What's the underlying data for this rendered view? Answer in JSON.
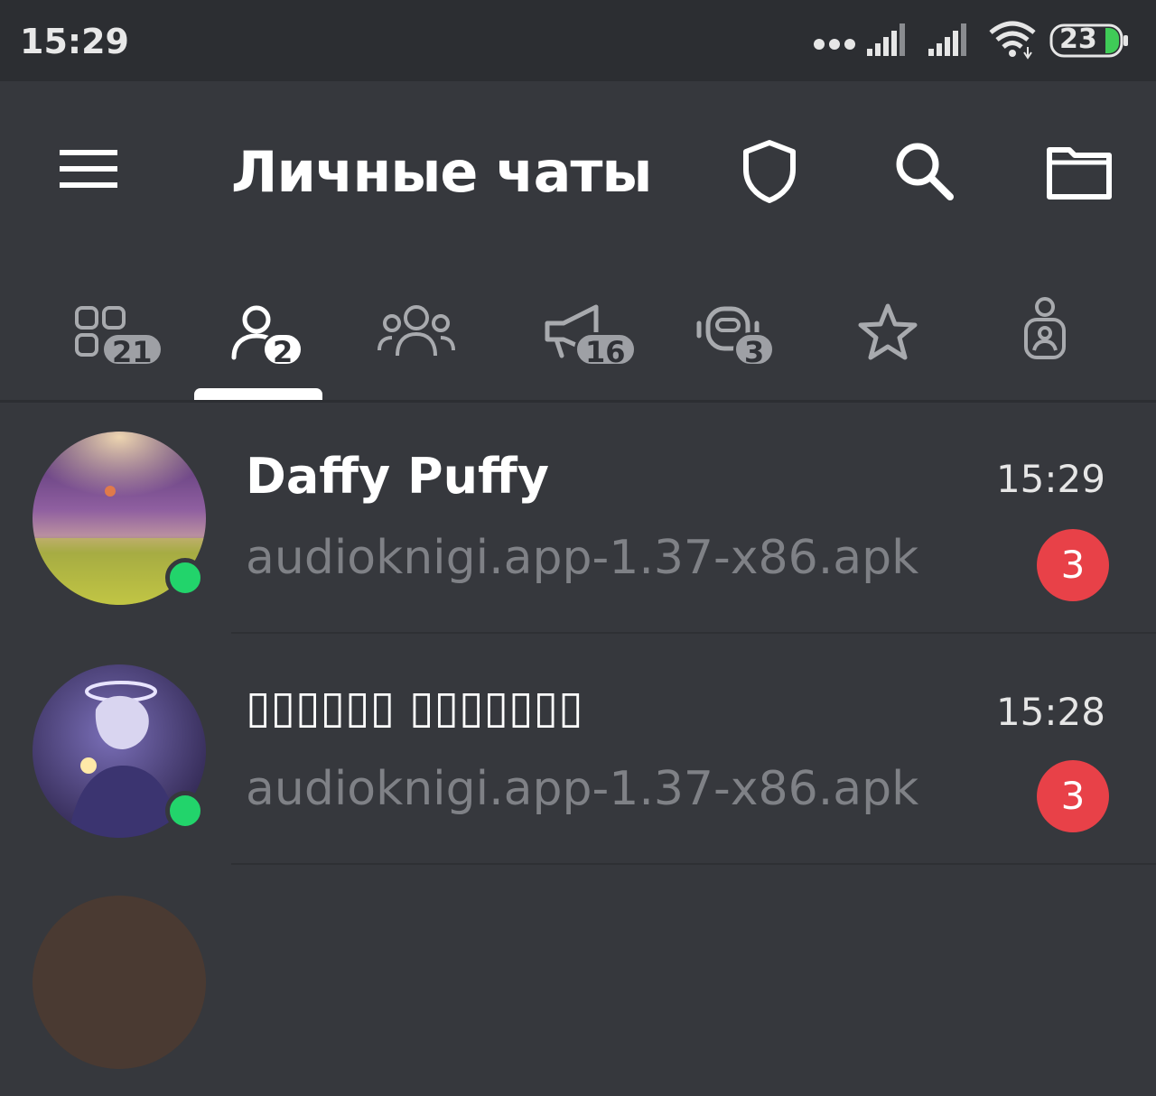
{
  "status_bar": {
    "time": "15:29",
    "battery_level": "23",
    "icons": [
      "more-dots-icon",
      "signal-icon",
      "signal-icon",
      "wifi-icon",
      "battery-icon"
    ]
  },
  "app_bar": {
    "title": "Личные чаты",
    "icons": [
      "menu-icon",
      "shield-icon",
      "search-icon",
      "folder-icon"
    ]
  },
  "tabs": [
    {
      "icon": "all-chats-icon",
      "badge": "21",
      "active": false
    },
    {
      "icon": "person-icon",
      "badge": "2",
      "active": true
    },
    {
      "icon": "group-icon",
      "badge": "",
      "active": false
    },
    {
      "icon": "megaphone-icon",
      "badge": "16",
      "active": false
    },
    {
      "icon": "bot-icon",
      "badge": "3",
      "active": false
    },
    {
      "icon": "star-icon",
      "badge": "",
      "active": false
    },
    {
      "icon": "contact-icon",
      "badge": "",
      "active": false
    }
  ],
  "chats": [
    {
      "name": "Daffy Puffy",
      "preview": "audioknigi.app-1.37-x86.apk",
      "time": "15:29",
      "unread": "3",
      "online": true
    },
    {
      "name": "▯▯▯▯▯▯ ▯▯▯▯▯▯▯",
      "preview": "audioknigi.app-1.37-x86.apk",
      "time": "15:28",
      "unread": "3",
      "online": true
    }
  ],
  "colors": {
    "background": "#36383d",
    "status_bar": "#2c2e32",
    "online": "#22d46b",
    "unread_badge": "#e84148",
    "preview_text": "#7f8186"
  }
}
